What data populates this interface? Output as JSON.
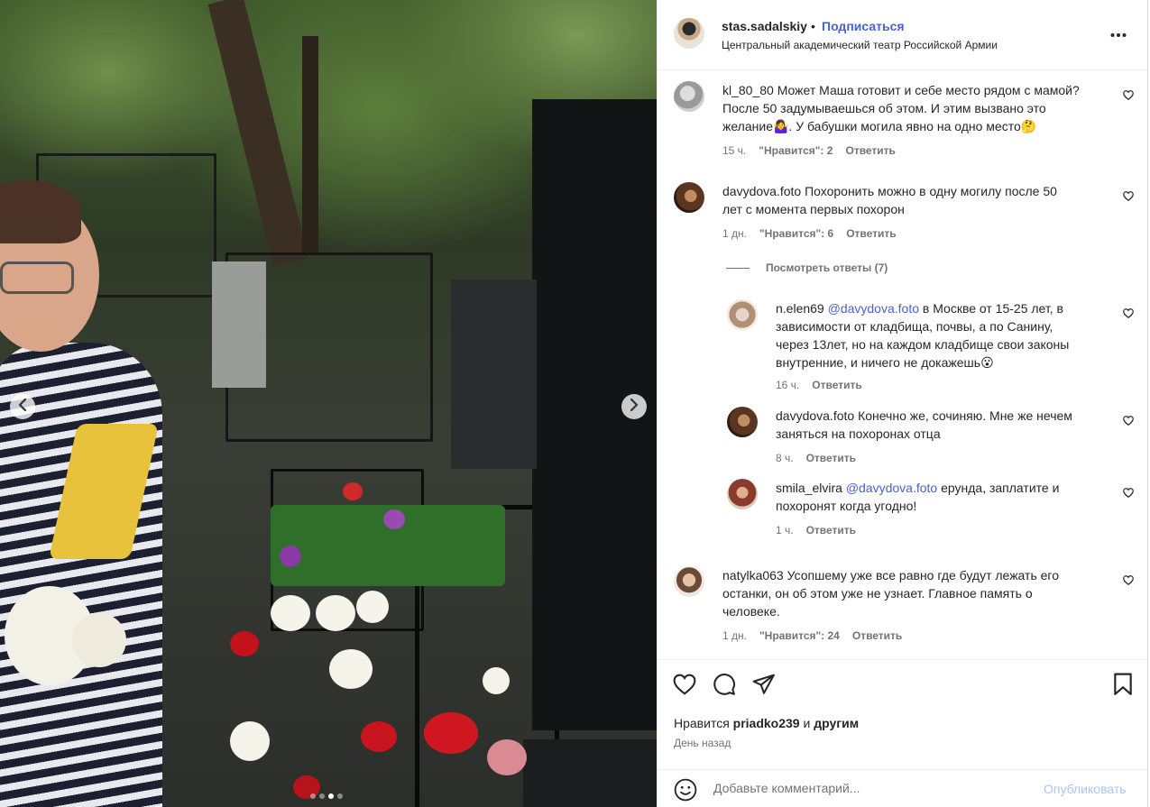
{
  "post": {
    "carousel": {
      "slides": 4,
      "active_slide": 3,
      "prev_icon": "chevron-left-icon",
      "next_icon": "chevron-right-icon"
    }
  },
  "header": {
    "username": "stas.sadalskiy",
    "bullet": "•",
    "follow_label": "Подписаться",
    "location": "Центральный академический театр Российской Армии",
    "more_icon": "more-horizontal-icon",
    "follow_color": "#4a5fd4"
  },
  "comments": [
    {
      "username": "kl_80_80",
      "text": "Может Маша готовит и себе место рядом с мамой? После 50 задумываешься об этом. И этим вызвано это желание🤷‍♀️. У бабушки могила явно на одно место🤔",
      "line1": "Может Маша готовит и себе место рядом с мамой?",
      "line2": "После 50 задумываешься об этом. И этим вызвано это",
      "line3": "желание🤷‍♀️. У бабушки могила явно на одно место🤔",
      "time": "15 ч.",
      "likes": "\"Нравится\": 2",
      "reply_label": "Ответить"
    },
    {
      "username": "davydova.foto",
      "line1": "Похоронить можно в одну могилу после 50",
      "line2": "лет с момента первых похорон",
      "time": "1 дн.",
      "likes": "\"Нравится\": 6",
      "reply_label": "Ответить",
      "view_replies": "Посмотреть ответы (7)",
      "replies": [
        {
          "username": "n.elen69",
          "mention": "@davydova.foto",
          "line1_rest": "в Москве от 15-25 лет, в",
          "line2": "зависимости от кладбища, почвы, а по Санину,",
          "line3": "через 13лет, но на каждом кладбище свои законы",
          "line4": "внутренние, и ничего не докажешь😮",
          "time": "16 ч.",
          "reply_label": "Ответить"
        },
        {
          "username": "davydova.foto",
          "line1": "Конечно же, сочиняю. Мне же нечем",
          "line2": "заняться на похоронах отца",
          "time": "8 ч.",
          "reply_label": "Ответить"
        },
        {
          "username": "smila_elvira",
          "mention": "@davydova.foto",
          "line1_rest": "ерунда, заплатите и",
          "line2": "похоронят когда угодно!",
          "time": "1 ч.",
          "reply_label": "Ответить"
        }
      ]
    },
    {
      "username": "natylka063",
      "line1": "Усопшему уже все равно где будут лежать его",
      "line2": "останки, он об этом уже не узнает. Главное память о",
      "line3": "человеке.",
      "time": "1 дн.",
      "likes": "\"Нравится\": 24",
      "reply_label": "Ответить"
    }
  ],
  "actions": {
    "like_icon": "heart-icon",
    "comment_icon": "comment-icon",
    "share_icon": "send-icon",
    "save_icon": "bookmark-icon",
    "likes_prefix": "Нравится",
    "likes_user": "priadko239",
    "likes_suffix": "и",
    "likes_others": "другим",
    "date": "День назад"
  },
  "add_comment": {
    "emoji_icon": "emoji-icon",
    "placeholder": "Добавьте комментарий...",
    "post_label": "Опубликовать"
  }
}
